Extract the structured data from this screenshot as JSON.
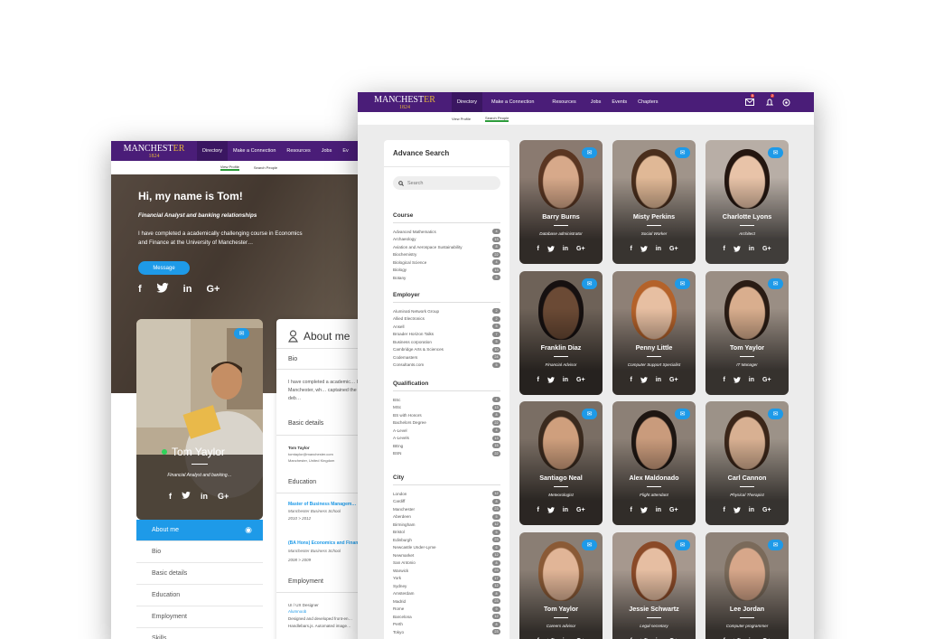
{
  "back_window": {
    "nav": {
      "brand_top": "MANCHEST",
      "brand_mid": "ER",
      "brand_year": "1824",
      "items": [
        "Directory",
        "Make a Connection",
        "Resources",
        "Jobs",
        "Ev"
      ]
    },
    "subnav": [
      "View Profile",
      "Search People"
    ],
    "hero": {
      "greeting": "Hi, my name is Tom!",
      "subtitle": "Financial Analyst and banking relationships",
      "intro": "I have completed a academically challenging course in Economics and Finance at the University of Manchester…",
      "message_button": "Message",
      "socials": [
        "f",
        "t",
        "in",
        "G+"
      ]
    },
    "card": {
      "name": "Tom Yaylor",
      "role": "Financial Analyst and banking…",
      "socials": [
        "f",
        "t",
        "in",
        "G+"
      ]
    },
    "menu": [
      "About me",
      "Bio",
      "Basic details",
      "Education",
      "Employment",
      "Skills"
    ],
    "about": {
      "title": "About me",
      "bio_label": "Bio",
      "bio_text": "I have completed a academic… University of Manchester, wh… captained the university deb…",
      "basic_label": "Basic details",
      "basic_name": "Tom Taylor",
      "basic_email": "tomtaylor@manchester.com",
      "basic_location": "Manchester, United Kingdom",
      "education_label": "Education",
      "edu1_title": "Master of Business Managem…",
      "edu1_school": "Manchester Business School",
      "edu1_dates": "2010 > 2012",
      "edu2_title": "(BA Hons) Economics and Finan…",
      "edu2_school": "Manchester Business School",
      "edu2_dates": "2008 > 2009",
      "employment_label": "Employment",
      "emp_title": "UI / UX Designer",
      "emp_company": "Alumnoob",
      "emp_text1": "Designed and developed front-en…",
      "emp_text2": "Handlebars.js. Automated image…"
    }
  },
  "front_window": {
    "nav": {
      "brand_top": "MANCHEST",
      "brand_mid": "ER",
      "brand_year": "1824",
      "items": [
        "Directory",
        "Make a Connection",
        "Resources",
        "Jobs",
        "Events",
        "Chapters"
      ],
      "notif_count": "5",
      "alert_count": "2"
    },
    "subnav": [
      "View Profile",
      "Search People"
    ],
    "search": {
      "title": "Advance Search",
      "placeholder": "Search",
      "sections": [
        {
          "title": "Course",
          "options": [
            [
              "Advanced Mathematics",
              "4"
            ],
            [
              "Archaeology",
              "13"
            ],
            [
              "Aviation and Aerospace Sustainability",
              "8"
            ],
            [
              "Biochemistry",
              "22"
            ],
            [
              "Biological Science",
              "4"
            ],
            [
              "Biology",
              "13"
            ],
            [
              "Botany",
              "5"
            ]
          ]
        },
        {
          "title": "Employer",
          "options": [
            [
              "Aluminati Network Group",
              "2"
            ],
            [
              "Allied Electronics",
              "2"
            ],
            [
              "Ansell",
              "5"
            ],
            [
              "Broader Horizon Talks",
              "7"
            ],
            [
              "Business corporation",
              "5"
            ],
            [
              "Cambridge Arts & Sciences",
              "10"
            ],
            [
              "Codemasters",
              "24"
            ],
            [
              "Consultants.com",
              "5"
            ]
          ]
        },
        {
          "title": "Qualification",
          "options": [
            [
              "BSc",
              "4"
            ],
            [
              "MSc",
              "13"
            ],
            [
              "BS with Honors",
              "8"
            ],
            [
              "Bachelors Degree",
              "22"
            ],
            [
              "A-Level",
              "4"
            ],
            [
              "A-Levels",
              "13"
            ],
            [
              "BEng",
              "15"
            ],
            [
              "BSN",
              "22"
            ]
          ]
        },
        {
          "title": "City",
          "options": [
            [
              "London",
              "12"
            ],
            [
              "Cardiff",
              "8"
            ],
            [
              "Manchester",
              "23"
            ],
            [
              "Aberdeen",
              "5"
            ],
            [
              "Birmingham",
              "12"
            ],
            [
              "Bristol",
              "5"
            ],
            [
              "Edinburgh",
              "23"
            ],
            [
              "Newcastle Under-Lyme",
              "6"
            ],
            [
              "Newmarket",
              "12"
            ],
            [
              "San Antonio",
              "8"
            ],
            [
              "Warwick",
              "23"
            ],
            [
              "York",
              "17"
            ],
            [
              "Sydney",
              "12"
            ],
            [
              "Amsterdam",
              "8"
            ],
            [
              "Madrid",
              "23"
            ],
            [
              "Rome",
              "9"
            ],
            [
              "Barcelona",
              "12"
            ],
            [
              "Perth",
              "8"
            ],
            [
              "Tokyo",
              "23"
            ]
          ]
        }
      ]
    },
    "people": [
      {
        "name": "Barry Burns",
        "role": "Database administrator"
      },
      {
        "name": "Misty Perkins",
        "role": "Social Worker"
      },
      {
        "name": "Charlotte Lyons",
        "role": "Architect"
      },
      {
        "name": "Franklin Diaz",
        "role": "Financial Advisor"
      },
      {
        "name": "Penny Little",
        "role": "Computer Support Specialist"
      },
      {
        "name": "Tom Yaylor",
        "role": "IT Manager"
      },
      {
        "name": "Santiago Neal",
        "role": "Meteorologist"
      },
      {
        "name": "Alex Maldonado",
        "role": "Flight attendant"
      },
      {
        "name": "Carl Cannon",
        "role": "Physical Therapist"
      },
      {
        "name": "Tom Yaylor",
        "role": "Careers advisor"
      },
      {
        "name": "Jessie Schwartz",
        "role": "Legal secretary"
      },
      {
        "name": "Lee Jordan",
        "role": "Computer programmer"
      }
    ],
    "card_socials": [
      "f",
      "t",
      "in",
      "G+"
    ]
  },
  "colors": {
    "nav_purple": "#4a1d78",
    "accent_blue": "#1e9ae8",
    "brand_gold": "#e3b33c"
  }
}
